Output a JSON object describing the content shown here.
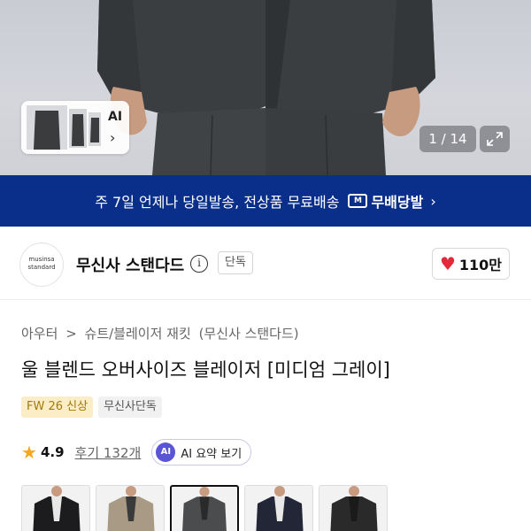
{
  "hero": {
    "ai_thumb": {
      "label": "AI",
      "chevron": "›"
    },
    "counter": "1 / 14",
    "expand_icon": "expand-icon"
  },
  "banner": {
    "text": "주 7일 언제나 당일발송, 전상품 무료배송",
    "badge_icon": "M",
    "badge_text": "무배당발",
    "arrow": "›"
  },
  "brand": {
    "logo_text_1": "musinsa",
    "logo_text_2": "standard",
    "name": "무신사 스탠다드",
    "info_icon": "i",
    "exclusive": "단독",
    "likes": "110만"
  },
  "breadcrumb": [
    "아우터",
    ">",
    "슈트/블레이저 재킷",
    "(무신사 스탠다드)"
  ],
  "product": {
    "title": "울 블렌드 오버사이즈 블레이저 [미디엄 그레이]",
    "tag_season": "FW 26 신상",
    "tag_exclusive": "무신사단독",
    "rating": "4.9",
    "reviews": "후기 132개",
    "ai_summary_icon": "AI",
    "ai_summary": "AI 요약 보기"
  },
  "colors": {
    "accent_blue": "#0a2f8a",
    "heart_red": "#e3283a",
    "star": "#f5a623",
    "swatches": [
      "#1c1c1e",
      "#a89a84",
      "#4a4c4e",
      "#222636",
      "#2a2a2a"
    ]
  }
}
